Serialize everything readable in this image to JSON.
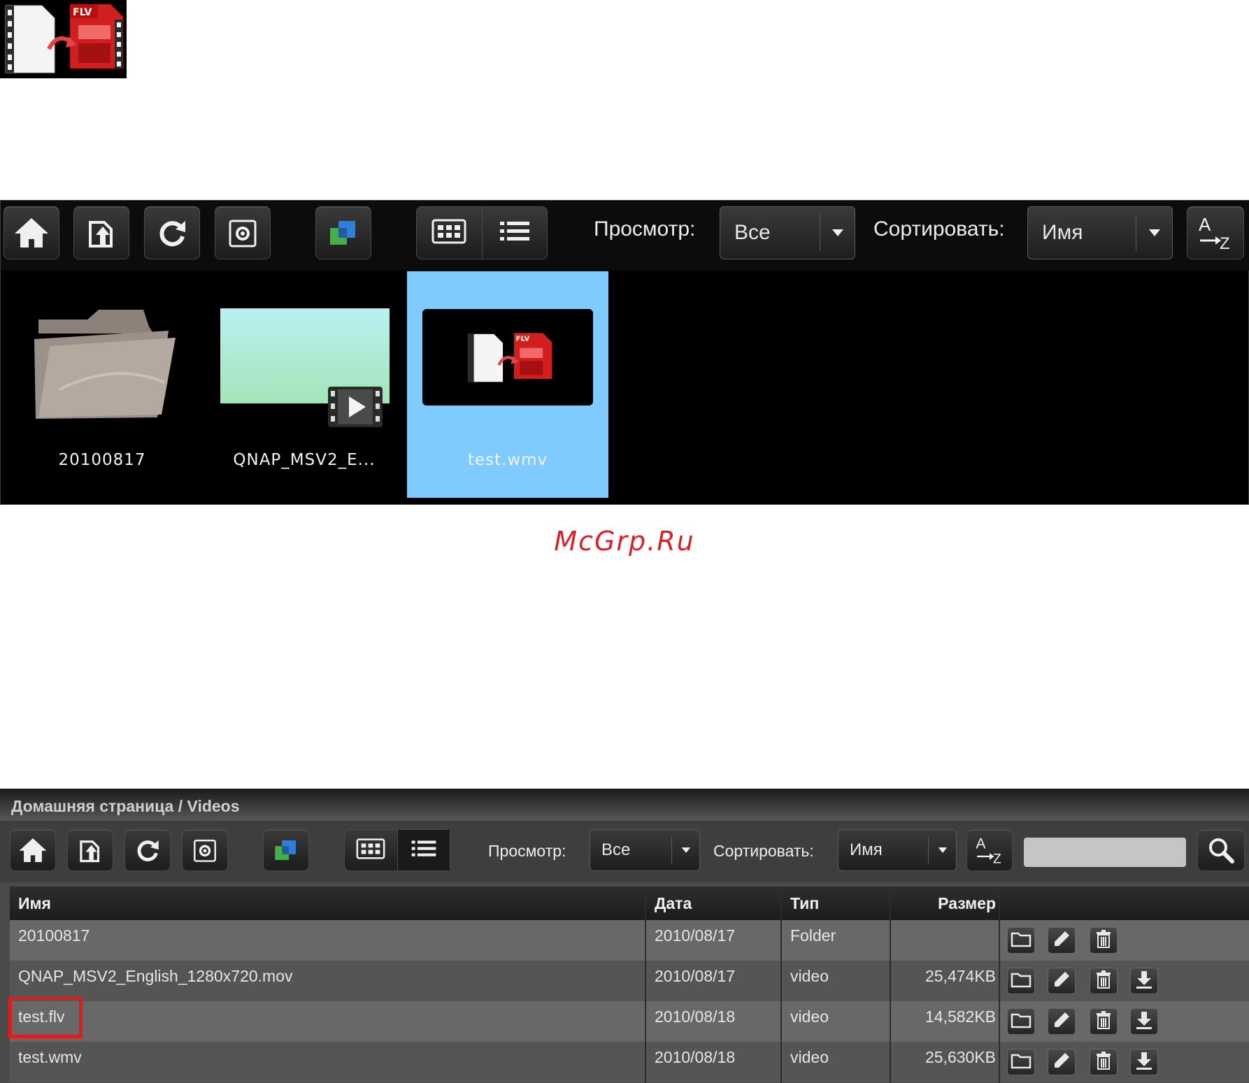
{
  "toolbar": {
    "view_label": "Просмотр:",
    "view_value": "Все",
    "sort_label": "Сортировать:",
    "sort_value": "Имя",
    "buttons": [
      "home-icon",
      "upload-icon",
      "refresh-icon",
      "settings-icon",
      "multi-window-icon",
      "thumbnail-view-icon",
      "list-view-icon",
      "sort-az-icon"
    ]
  },
  "thumbnails": [
    {
      "label": "20100817",
      "kind": "folder"
    },
    {
      "label": "QNAP_MSV2_E...",
      "kind": "video"
    },
    {
      "label": "test.wmv",
      "kind": "converting",
      "selected": true
    }
  ],
  "watermark": "McGrp.Ru",
  "list_view": {
    "breadcrumb": "Домашняя страница  / Videos",
    "search": {
      "value": "",
      "button": "search-icon"
    },
    "columns": [
      "Имя",
      "Дата",
      "Тип",
      "Размер"
    ],
    "rows": [
      {
        "name": "20100817",
        "date": "2010/08/17",
        "type": "Folder",
        "size": "",
        "actions": [
          "folder-icon",
          "edit-icon",
          "trash-icon"
        ]
      },
      {
        "name": "QNAP_MSV2_English_1280x720.mov",
        "date": "2010/08/17",
        "type": "video",
        "size": "25,474KB",
        "actions": [
          "folder-icon",
          "edit-icon",
          "trash-icon",
          "download-icon"
        ]
      },
      {
        "name": "test.flv",
        "date": "2010/08/18",
        "type": "video",
        "size": "14,582KB",
        "highlighted": true,
        "actions": [
          "folder-icon",
          "edit-icon",
          "trash-icon",
          "download-icon"
        ]
      },
      {
        "name": "test.wmv",
        "date": "2010/08/18",
        "type": "video",
        "size": "25,630KB",
        "actions": [
          "folder-icon",
          "edit-icon",
          "trash-icon",
          "download-icon"
        ]
      }
    ]
  },
  "colors": {
    "selected_bg": "#7fcbff",
    "highlight_box": "#e11b1b",
    "watermark": "#d6232a"
  }
}
